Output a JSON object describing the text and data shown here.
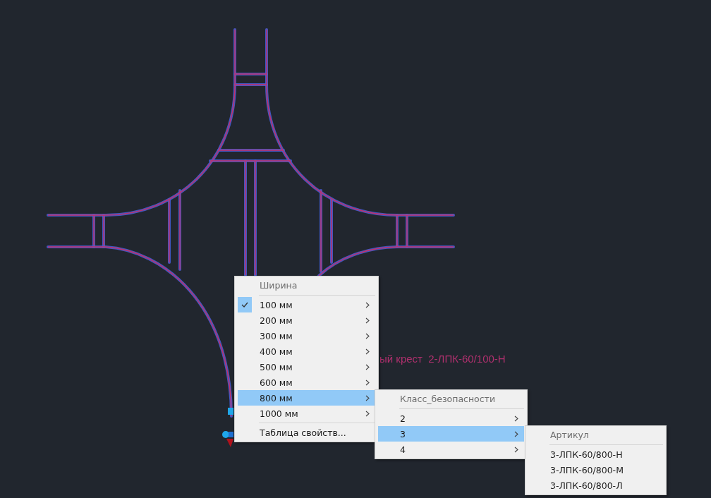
{
  "drawing": {
    "label": "ый крест  2-ЛПК-60/100-Н"
  },
  "menus": [
    {
      "header": "Ширина",
      "items": [
        {
          "kind": "option",
          "label": "100 мм",
          "checked": true,
          "selected": false,
          "submenu": true
        },
        {
          "kind": "option",
          "label": "200 мм",
          "checked": false,
          "selected": false,
          "submenu": true
        },
        {
          "kind": "option",
          "label": "300 мм",
          "checked": false,
          "selected": false,
          "submenu": true
        },
        {
          "kind": "option",
          "label": "400 мм",
          "checked": false,
          "selected": false,
          "submenu": true
        },
        {
          "kind": "option",
          "label": "500 мм",
          "checked": false,
          "selected": false,
          "submenu": true
        },
        {
          "kind": "option",
          "label": "600 мм",
          "checked": false,
          "selected": false,
          "submenu": true
        },
        {
          "kind": "option",
          "label": "800 мм",
          "checked": false,
          "selected": true,
          "submenu": true
        },
        {
          "kind": "option",
          "label": "1000 мм",
          "checked": false,
          "selected": false,
          "submenu": true
        },
        {
          "kind": "separator"
        },
        {
          "kind": "option",
          "label": "Таблица свойств...",
          "checked": false,
          "selected": false,
          "submenu": false
        }
      ]
    },
    {
      "header": "Класс_безопасности",
      "items": [
        {
          "kind": "option",
          "label": "2",
          "selected": false,
          "submenu": true
        },
        {
          "kind": "option",
          "label": "3",
          "selected": true,
          "submenu": true
        },
        {
          "kind": "option",
          "label": "4",
          "selected": false,
          "submenu": true
        }
      ]
    },
    {
      "header": "Артикул",
      "items": [
        {
          "kind": "option",
          "label": "3-ЛПК-60/800-Н",
          "selected": false,
          "submenu": false
        },
        {
          "kind": "option",
          "label": "3-ЛПК-60/800-М",
          "selected": false,
          "submenu": false
        },
        {
          "kind": "option",
          "label": "3-ЛПК-60/800-Л",
          "selected": false,
          "submenu": false
        }
      ]
    }
  ]
}
